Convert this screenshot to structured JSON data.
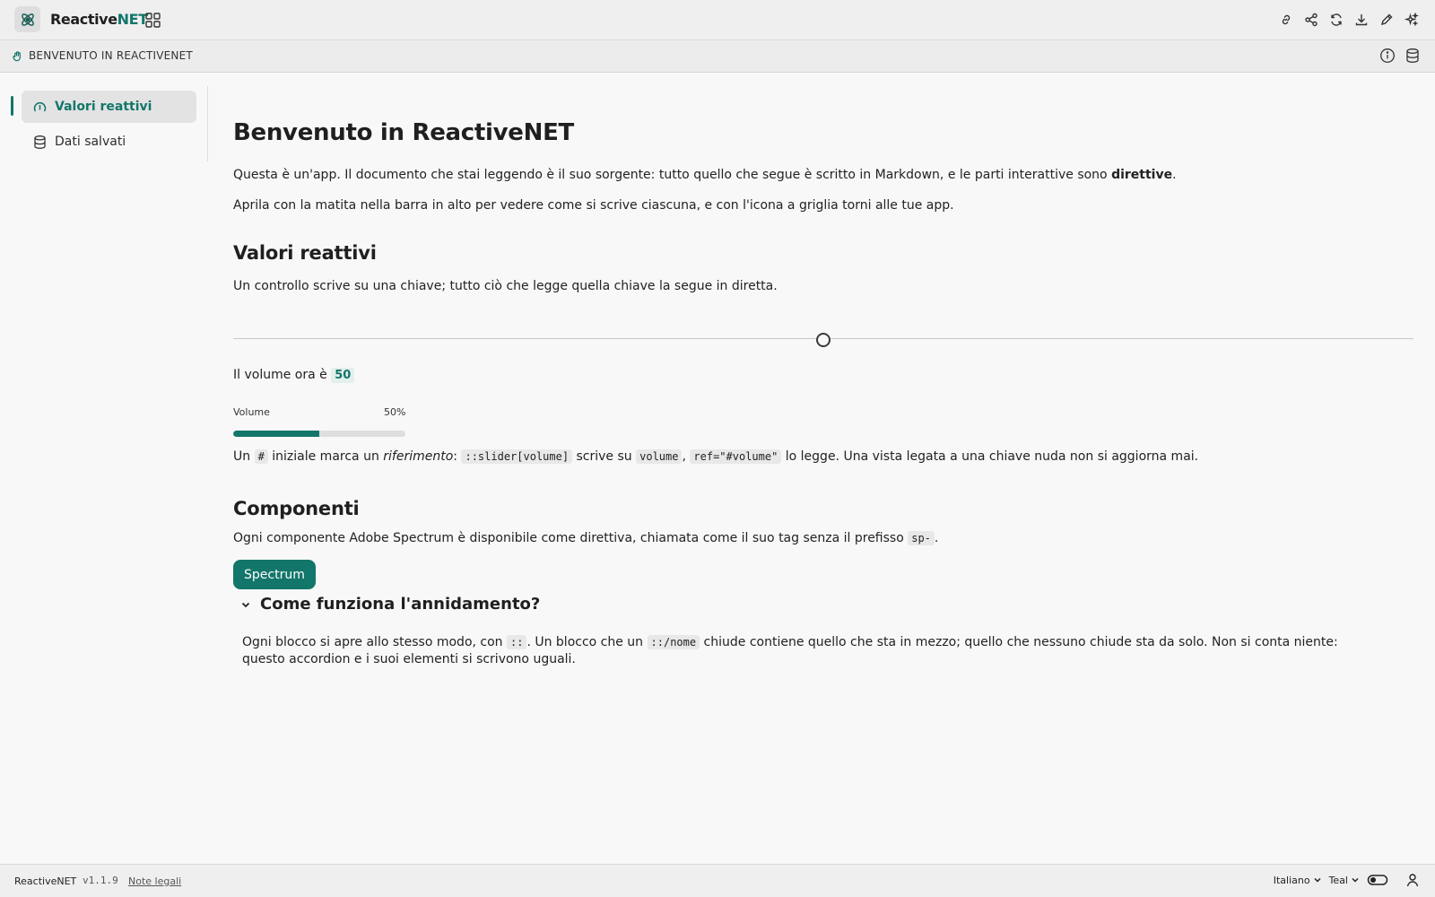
{
  "app": {
    "name_main": "Reactive",
    "name_accent": "NET",
    "logo_icon": "atom-icon"
  },
  "colors": {
    "accent": "#13766a",
    "chip_bg": "#e3efec"
  },
  "toolbar": {
    "icons": [
      "link-icon",
      "share-icon",
      "refresh-icon",
      "download-icon",
      "edit-icon",
      "sparkle-icon"
    ]
  },
  "breadcrumb": {
    "label": "BENVENUTO IN REACTIVENET"
  },
  "sidebar": {
    "items": [
      {
        "label": "Valori reattivi",
        "icon": "gauge-icon"
      },
      {
        "label": "Dati salvati",
        "icon": "database-icon"
      }
    ]
  },
  "page": {
    "title": "Benvenuto in ReactiveNET",
    "intro_pre": "Questa è un'app. Il documento che stai leggendo è il suo sorgente: tutto quello che segue è scritto in Markdown, e le parti interattive sono ",
    "intro_bold": "direttive",
    "intro_post": ".",
    "intro2": "Aprila con la matita nella barra in alto per vedere come si scrive ciascuna, e con l'icona a griglia torni alle tue app.",
    "section1": {
      "title": "Valori reattivi",
      "text": "Un controllo scrive su una chiave; tutto ciò che legge quella chiave la segue in diretta."
    },
    "volume": {
      "value": 50,
      "value_text": "50",
      "readout_label": "Il volume ora è",
      "meter_label": "Volume",
      "meter_percent": "50%"
    },
    "ref_text": {
      "p1": "Un ",
      "c1": "#",
      "p2": " iniziale marca un ",
      "em": "riferimento",
      "p3": ": ",
      "c2": "::slider[volume]",
      "p4": " scrive su ",
      "c3": "volume",
      "p5": ", ",
      "c4": "ref=\"#volume\"",
      "p6": " lo legge. Una vista legata a una chiave nuda non si aggiorna mai."
    },
    "section2": {
      "title": "Componenti",
      "text_pre": "Ogni componente Adobe Spectrum è disponibile come direttiva, chiamata come il suo tag senza il prefisso ",
      "code": "sp-",
      "text_post": "."
    },
    "button_label": "Spectrum",
    "accordion": {
      "title": "Come funziona l'annidamento?",
      "p1": "Ogni blocco si apre allo stesso modo, con ",
      "c1": "::",
      "p2": ". Un blocco che un ",
      "c2": "::/nome",
      "p3": " chiude contiene quello che sta in mezzo; quello che nessuno chiude sta da solo. Non si conta niente: questo accordion e i suoi elementi si scrivono uguali."
    }
  },
  "footer": {
    "brand": "ReactiveNET",
    "version": "v1.1.9",
    "legal": "Note legali",
    "language": "Italiano",
    "theme": "Teal"
  }
}
